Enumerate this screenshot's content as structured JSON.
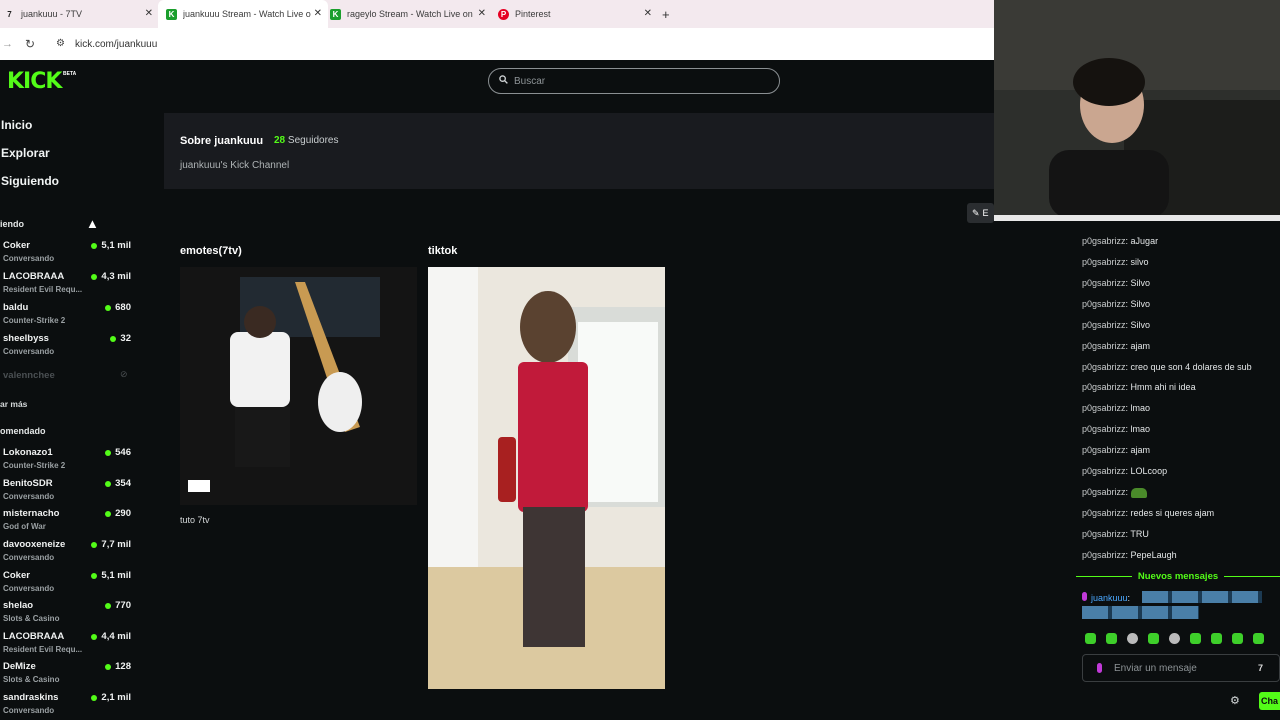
{
  "browser": {
    "tabs": [
      {
        "label": "juankuuu - 7TV",
        "favicon": "7tv-icon",
        "active": false
      },
      {
        "label": "juankuuu Stream - Watch Live o",
        "favicon": "kick-icon",
        "active": true
      },
      {
        "label": "rageylo Stream - Watch Live on",
        "favicon": "kick-icon",
        "active": false
      },
      {
        "label": "Pinterest",
        "favicon": "pinterest-icon",
        "active": false
      }
    ],
    "new_tab": "+",
    "url": "kick.com/juankuuu"
  },
  "kick": {
    "logo": "KICK",
    "logo_badge": "BETA",
    "search_placeholder": "Buscar",
    "nav": [
      "Inicio",
      "Explorar",
      "Siguiendo"
    ],
    "following_label": "iendo",
    "following": [
      {
        "name": "Coker",
        "game": "Conversando",
        "viewers": "5,1 mil"
      },
      {
        "name": "LACOBRAAA",
        "game": "Resident Evil Requ...",
        "viewers": "4,3 mil"
      },
      {
        "name": "baldu",
        "game": "Counter-Strike 2",
        "viewers": "680"
      },
      {
        "name": "sheelbyss",
        "game": "Conversando",
        "viewers": "32"
      }
    ],
    "offline_channel": "valennchee",
    "show_more": "ar más",
    "recommended_label": "omendado",
    "recommended": [
      {
        "name": "Lokonazo1",
        "game": "Counter-Strike 2",
        "viewers": "546"
      },
      {
        "name": "BenitoSDR",
        "game": "Conversando",
        "viewers": "354"
      },
      {
        "name": "misternacho",
        "game": "God of War",
        "viewers": "290"
      },
      {
        "name": "davooxeneize",
        "game": "Conversando",
        "viewers": "7,7 mil"
      },
      {
        "name": "Coker",
        "game": "Conversando",
        "viewers": "5,1 mil"
      },
      {
        "name": "shelao",
        "game": "Slots & Casino",
        "viewers": "770"
      },
      {
        "name": "LACOBRAAA",
        "game": "Resident Evil Requ...",
        "viewers": "4,4 mil"
      },
      {
        "name": "DeMize",
        "game": "Slots & Casino",
        "viewers": "128"
      },
      {
        "name": "sandraskins",
        "game": "Conversando",
        "viewers": "2,1 mil"
      }
    ],
    "about": {
      "title": "Sobre juankuuu",
      "followers_count": "28",
      "followers_label": "Seguidores",
      "description": "juankuuu's Kick Channel"
    },
    "panels": [
      {
        "title": "emotes(7tv)",
        "caption": "tuto 7tv"
      },
      {
        "title": "tiktok",
        "caption": ""
      }
    ],
    "edit_label": "E"
  },
  "chat": {
    "messages": [
      {
        "user": "p0gsabrizz",
        "text": "aJugar"
      },
      {
        "user": "p0gsabrizz",
        "text": "silvo"
      },
      {
        "user": "p0gsabrizz",
        "text": "Silvo"
      },
      {
        "user": "p0gsabrizz",
        "text": "Silvo"
      },
      {
        "user": "p0gsabrizz",
        "text": "Silvo"
      },
      {
        "user": "p0gsabrizz",
        "text": "ajam"
      },
      {
        "user": "p0gsabrizz",
        "text": "creo que son 4 dolares de sub"
      },
      {
        "user": "p0gsabrizz",
        "text": "Hmm ahi ni idea"
      },
      {
        "user": "p0gsabrizz",
        "text": "lmao"
      },
      {
        "user": "p0gsabrizz",
        "text": "lmao"
      },
      {
        "user": "p0gsabrizz",
        "text": "ajam"
      },
      {
        "user": "p0gsabrizz",
        "text": "LOLcoop"
      },
      {
        "user": "p0gsabrizz",
        "text": ""
      },
      {
        "user": "p0gsabrizz",
        "text": "redes si queres ajam"
      },
      {
        "user": "p0gsabrizz",
        "text": "TRU"
      },
      {
        "user": "p0gsabrizz",
        "text": "PepeLaugh"
      }
    ],
    "new_messages": "Nuevos mensajes",
    "highlight_user": "juankuuu",
    "input_placeholder": "Enviar un mensaje",
    "send_label": "Cha"
  },
  "colors": {
    "accent": "#53fc18",
    "bg": "#0b0e0f",
    "panel": "#191b1f"
  }
}
